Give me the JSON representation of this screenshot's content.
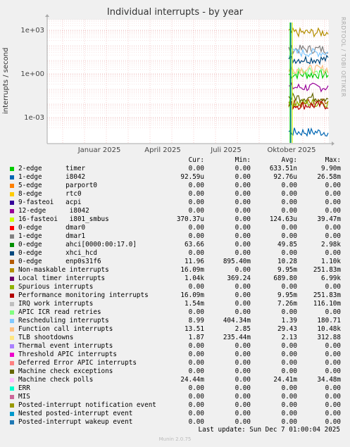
{
  "chart_data": {
    "type": "line",
    "title": "Individual interrupts - by year",
    "ylabel": "interrupts / second",
    "y_scale": "log",
    "y_ticks": [
      "1e+03",
      "1e+00",
      "1e-03"
    ],
    "x_ticks": [
      "Januar 2025",
      "April 2025",
      "Juli 2025",
      "Oktober 2025"
    ],
    "grid": true,
    "side_label": "RRDTOOL / TOBI OETIKER",
    "data_start": "Oktober 2025",
    "series": [
      {
        "name": "timer",
        "color": "#00cc00",
        "level": 0.9
      },
      {
        "name": "i8042",
        "color": "#0066b3",
        "level": 0.0001
      },
      {
        "name": "parport0",
        "color": "#ff8000",
        "level": 0
      },
      {
        "name": "rtc0",
        "color": "#ffcc00",
        "level": 0
      },
      {
        "name": "acpi",
        "color": "#330099",
        "level": 0
      },
      {
        "name": "i801_smbus",
        "color": "#990099",
        "level": 0.12
      },
      {
        "name": "dmar0",
        "color": "#ccff00",
        "level": 0
      },
      {
        "name": "dmar1",
        "color": "#ff0000",
        "level": 0
      },
      {
        "name": "ahci[0000:00:17.0]",
        "color": "#808080",
        "level": 50
      },
      {
        "name": "xhci_hcd",
        "color": "#008f00",
        "level": 0
      },
      {
        "name": "enp0s31f6",
        "color": "#00487d",
        "level": 10
      },
      {
        "name": "Non-maskable interrupts",
        "color": "#b35a00",
        "level": 0.01
      },
      {
        "name": "Local timer interrupts",
        "color": "#b38f00",
        "level": 690
      },
      {
        "name": "Spurious interrupts",
        "color": "#6b006b",
        "level": 0
      },
      {
        "name": "Performance monitoring interrupts",
        "color": "#8fb300",
        "level": 0.01
      },
      {
        "name": "IRQ work interrupts",
        "color": "#b30000",
        "level": 0.007
      },
      {
        "name": "APIC ICR read retries",
        "color": "#bebebe",
        "level": 0
      },
      {
        "name": "Rescheduling interrupts",
        "color": "#80ff80",
        "level": 1.4
      },
      {
        "name": "Function call interrupts",
        "color": "#80c9ff",
        "level": 29
      },
      {
        "name": "TLB shootdowns",
        "color": "#ffc080",
        "level": 2.1
      },
      {
        "name": "Thermal event interrupts",
        "color": "#ffe680",
        "level": 0
      },
      {
        "name": "Threshold APIC interrupts",
        "color": "#aa80ff",
        "level": 0
      },
      {
        "name": "Deferred Error APIC interrupts",
        "color": "#ee00cc",
        "level": 0
      },
      {
        "name": "Machine check exceptions",
        "color": "#ff8080",
        "level": 0
      },
      {
        "name": "Machine check polls",
        "color": "#666600",
        "level": 0.024
      },
      {
        "name": "ERR",
        "color": "#ffbfff",
        "level": 0
      },
      {
        "name": "MIS",
        "color": "#00ffcc",
        "level": 0
      },
      {
        "name": "Posted-interrupt notification event",
        "color": "#cc6699",
        "level": 0
      },
      {
        "name": "Nested posted-interrupt event",
        "color": "#999900",
        "level": 0
      },
      {
        "name": "Posted-interrupt wakeup event",
        "color": "#0099cc",
        "level": 0
      }
    ]
  },
  "legend": {
    "headers": {
      "cur": "Cur:",
      "min": "Min:",
      "avg": "Avg:",
      "max": "Max:"
    },
    "rows": [
      {
        "label": "2-edge      timer",
        "color": "#00cc00",
        "cur": "0.00",
        "min": "0.00",
        "avg": "633.51n",
        "max": "9.90m"
      },
      {
        "label": "1-edge      i8042",
        "color": "#0066b3",
        "cur": "92.59u",
        "min": "0.00",
        "avg": "92.76u",
        "max": "26.58m"
      },
      {
        "label": "5-edge      parport0",
        "color": "#ff8000",
        "cur": "0.00",
        "min": "0.00",
        "avg": "0.00",
        "max": "0.00"
      },
      {
        "label": "8-edge      rtc0",
        "color": "#ffcc00",
        "cur": "0.00",
        "min": "0.00",
        "avg": "0.00",
        "max": "0.00"
      },
      {
        "label": "9-fasteoi   acpi",
        "color": "#330099",
        "cur": "0.00",
        "min": "0.00",
        "avg": "0.00",
        "max": "0.00"
      },
      {
        "label": "12-edge      i8042",
        "color": "#990099",
        "cur": "0.00",
        "min": "0.00",
        "avg": "0.00",
        "max": "0.00"
      },
      {
        "label": "16-fasteoi   i801_smbus",
        "color": "#ccff00",
        "cur": "370.37u",
        "min": "0.00",
        "avg": "124.63u",
        "max": "39.47m"
      },
      {
        "label": "0-edge      dmar0",
        "color": "#ff0000",
        "cur": "0.00",
        "min": "0.00",
        "avg": "0.00",
        "max": "0.00"
      },
      {
        "label": "1-edge      dmar1",
        "color": "#808080",
        "cur": "0.00",
        "min": "0.00",
        "avg": "0.00",
        "max": "0.00"
      },
      {
        "label": "0-edge      ahci[0000:00:17.0]",
        "color": "#008f00",
        "cur": "63.66",
        "min": "0.00",
        "avg": "49.85",
        "max": "2.98k"
      },
      {
        "label": "0-edge      xhci_hcd",
        "color": "#00487d",
        "cur": "0.00",
        "min": "0.00",
        "avg": "0.00",
        "max": "0.00"
      },
      {
        "label": "0-edge      enp0s31f6",
        "color": "#b35a00",
        "cur": "11.96",
        "min": "895.40m",
        "avg": "10.28",
        "max": "1.10k"
      },
      {
        "label": "Non-maskable interrupts",
        "color": "#b38f00",
        "cur": "16.09m",
        "min": "0.00",
        "avg": "9.95m",
        "max": "251.83m"
      },
      {
        "label": "Local timer interrupts",
        "color": "#6b006b",
        "cur": "1.04k",
        "min": "369.24",
        "avg": "689.80",
        "max": "6.99k"
      },
      {
        "label": "Spurious interrupts",
        "color": "#8fb300",
        "cur": "0.00",
        "min": "0.00",
        "avg": "0.00",
        "max": "0.00"
      },
      {
        "label": "Performance monitoring interrupts",
        "color": "#b30000",
        "cur": "16.09m",
        "min": "0.00",
        "avg": "9.95m",
        "max": "251.83m"
      },
      {
        "label": "IRQ work interrupts",
        "color": "#bebebe",
        "cur": "1.54m",
        "min": "0.00",
        "avg": "7.26m",
        "max": "116.10m"
      },
      {
        "label": "APIC ICR read retries",
        "color": "#80ff80",
        "cur": "0.00",
        "min": "0.00",
        "avg": "0.00",
        "max": "0.00"
      },
      {
        "label": "Rescheduling interrupts",
        "color": "#80c9ff",
        "cur": "8.99",
        "min": "404.34m",
        "avg": "1.39",
        "max": "180.71"
      },
      {
        "label": "Function call interrupts",
        "color": "#ffc080",
        "cur": "13.51",
        "min": "2.85",
        "avg": "29.43",
        "max": "10.48k"
      },
      {
        "label": "TLB shootdowns",
        "color": "#ffe680",
        "cur": "1.87",
        "min": "235.44m",
        "avg": "2.13",
        "max": "312.88"
      },
      {
        "label": "Thermal event interrupts",
        "color": "#aa80ff",
        "cur": "0.00",
        "min": "0.00",
        "avg": "0.00",
        "max": "0.00"
      },
      {
        "label": "Threshold APIC interrupts",
        "color": "#ee00cc",
        "cur": "0.00",
        "min": "0.00",
        "avg": "0.00",
        "max": "0.00"
      },
      {
        "label": "Deferred Error APIC interrupts",
        "color": "#ff8080",
        "cur": "0.00",
        "min": "0.00",
        "avg": "0.00",
        "max": "0.00"
      },
      {
        "label": "Machine check exceptions",
        "color": "#666600",
        "cur": "0.00",
        "min": "0.00",
        "avg": "0.00",
        "max": "0.00"
      },
      {
        "label": "Machine check polls",
        "color": "#ffbfff",
        "cur": "24.44m",
        "min": "0.00",
        "avg": "24.41m",
        "max": "34.48m"
      },
      {
        "label": "ERR",
        "color": "#00ffcc",
        "cur": "0.00",
        "min": "0.00",
        "avg": "0.00",
        "max": "0.00"
      },
      {
        "label": "MIS",
        "color": "#cc6699",
        "cur": "0.00",
        "min": "0.00",
        "avg": "0.00",
        "max": "0.00"
      },
      {
        "label": "Posted-interrupt notification event",
        "color": "#999900",
        "cur": "0.00",
        "min": "0.00",
        "avg": "0.00",
        "max": "0.00"
      },
      {
        "label": "Nested posted-interrupt event",
        "color": "#0099cc",
        "cur": "0.00",
        "min": "0.00",
        "avg": "0.00",
        "max": "0.00"
      },
      {
        "label": "Posted-interrupt wakeup event",
        "color": "#1f78b4",
        "cur": "0.00",
        "min": "0.00",
        "avg": "0.00",
        "max": "0.00"
      }
    ]
  },
  "footer": "Last update:  Sun Dec  7 01:00:04 2025",
  "munin_version": "Munin 2.0.75"
}
